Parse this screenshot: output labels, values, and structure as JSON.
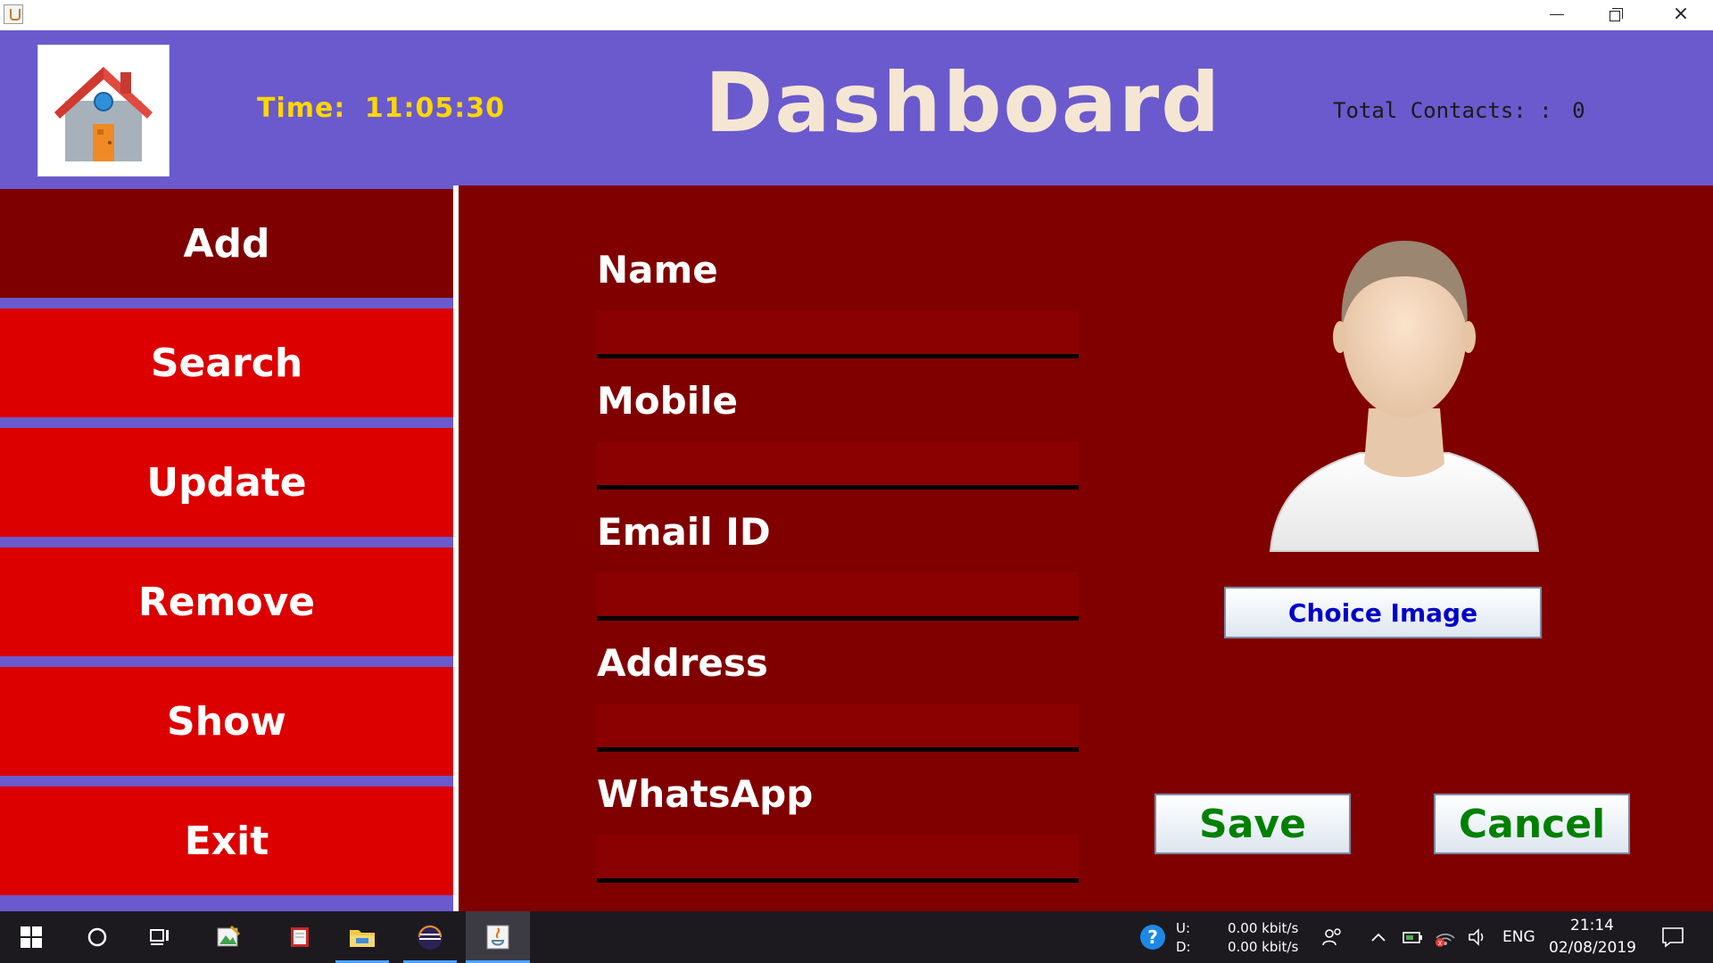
{
  "window": {
    "controls": {
      "minimize": "minimize",
      "maximize": "restore",
      "close": "×"
    }
  },
  "header": {
    "time_label": "Time:",
    "time_value": "11:05:30",
    "title": "Dashboard",
    "contacts_label": "Total Contacts: :",
    "contacts_count": "0"
  },
  "sidebar": {
    "items": [
      {
        "label": "Add",
        "active": true
      },
      {
        "label": "Search",
        "active": false
      },
      {
        "label": "Update",
        "active": false
      },
      {
        "label": "Remove",
        "active": false
      },
      {
        "label": "Show",
        "active": false
      },
      {
        "label": "Exit",
        "active": false
      }
    ]
  },
  "form": {
    "fields": [
      {
        "label": "Name",
        "value": ""
      },
      {
        "label": "Mobile",
        "value": ""
      },
      {
        "label": "Email ID",
        "value": ""
      },
      {
        "label": "Address",
        "value": ""
      },
      {
        "label": "WhatsApp",
        "value": ""
      }
    ],
    "choose_image_label": "Choice Image",
    "save_label": "Save",
    "cancel_label": "Cancel"
  },
  "taskbar": {
    "net_up_label": "U:",
    "net_down_label": "D:",
    "net_up": "0.00 kbit/s",
    "net_down": "0.00 kbit/s",
    "language": "ENG",
    "clock_time": "21:14",
    "clock_date": "02/08/2019"
  },
  "colors": {
    "header_bg": "#6a5acd",
    "nav_button": "#dc0000",
    "nav_active": "#7f0000",
    "main_bg": "#800000",
    "title_text": "#f5e6d3",
    "time_text": "#ffd700",
    "action_text": "#008000",
    "choose_text": "#0000c8"
  }
}
